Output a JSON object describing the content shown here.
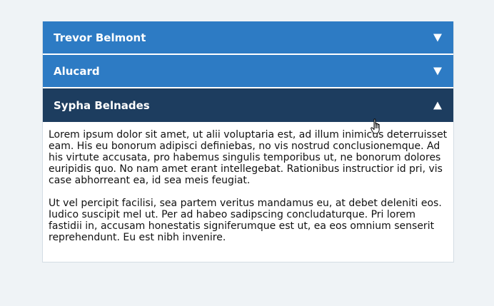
{
  "accordion": {
    "items": [
      {
        "title": "Trevor Belmont",
        "expanded": false,
        "icon": "arrow-down-icon"
      },
      {
        "title": "Alucard",
        "expanded": false,
        "icon": "arrow-down-icon"
      },
      {
        "title": "Sypha Belnades",
        "expanded": true,
        "icon": "arrow-up-icon",
        "paragraphs": [
          "Lorem ipsum dolor sit amet, ut alii voluptaria est, ad illum inimicus deterruisset eam. His eu bonorum adipisci definiebas, no vis nostrud conclusionemque. Ad his virtute accusata, pro habemus singulis temporibus ut, ne bonorum dolores euripidis quo. No nam amet erant intellegebat. Rationibus instructior id pri, vis case abhorreant ea, id sea meis feugiat.",
          "Ut vel percipit facilisi, sea partem veritus mandamus eu, at debet deleniti eos. Iudico suscipit mel ut. Per ad habeo sadipscing concludaturque. Pri lorem fastidii in, accusam honestatis signiferumque est ut, ea eos omnium senserit reprehendunt. Eu est nibh invenire."
        ]
      }
    ]
  },
  "colors": {
    "header_collapsed": "#2d7bc4",
    "header_expanded": "#1d3d5f",
    "page_background": "#eff3f6"
  }
}
